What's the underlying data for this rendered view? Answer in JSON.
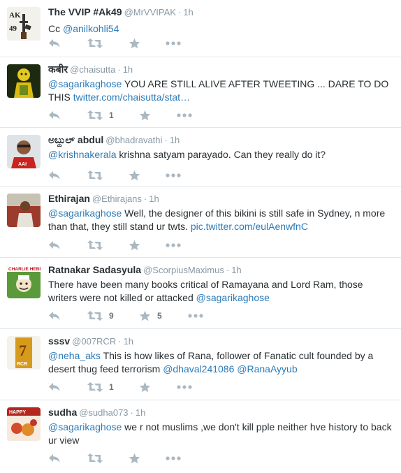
{
  "tweets": [
    {
      "name": "The VVIP #Ak49",
      "handle": "@MrVVIPAK",
      "time": "1h",
      "text_parts": [
        "Cc "
      ],
      "mentions": [
        "@anilkohli54"
      ],
      "avatar_icon": "rifle-ak49-avatar",
      "retweets": "",
      "favorites": ""
    },
    {
      "name": "कबीर",
      "handle": "@chaisutta",
      "time": "1h",
      "mention": "@sagarikaghose",
      "text_line1": " YOU ARE STILL ALIVE AFTER TWEETING ... DARE TO DO",
      "text_line2": "THIS ",
      "link": "twitter.com/chaisutta/stat…",
      "avatar_icon": "yellow-figure-avatar",
      "retweets": "1",
      "favorites": ""
    },
    {
      "name": "ಅಬ್ದುಲ್ abdul",
      "handle": "@bhadravathi",
      "time": "1h",
      "mention": "@krishnakerala",
      "text": " krishna satyam parayado. Can they really do it?",
      "avatar_icon": "man-red-shirt-avatar",
      "retweets": "",
      "favorites": ""
    },
    {
      "name": "Ethirajan",
      "handle": "@Ethirajans",
      "time": "1h",
      "mention": "@sagarikaghose",
      "text_line1": " Well, the designer of this bikini is still safe in Sydney, n more",
      "text_line2": "than that, they still stand ur twts. ",
      "link": "pic.twitter.com/eulAenwfnC",
      "avatar_icon": "person-photo-avatar",
      "retweets": "",
      "favorites": ""
    },
    {
      "name": "Ratnakar Sadasyula",
      "handle": "@ScorpiusMaximus",
      "time": "1h",
      "text_line1": "There have been many books critical of Ramayana and Lord Ram, those",
      "text_line2": "writers were not killed or attacked ",
      "mention": "@sagarikaghose",
      "avatar_icon": "charlie-hebdo-cover-avatar",
      "retweets": "9",
      "favorites": "5"
    },
    {
      "name": "sssv",
      "handle": "@007RCR",
      "time": "1h",
      "mention": "@neha_aks",
      "text_line1": " This is how likes of  Rana, follower of Fanatic cult founded by a",
      "text_line2": "desert thug feed terrorism ",
      "mention2": "@dhaval241086",
      "mention3": "@RanaAyyub",
      "avatar_icon": "7-rcr-logo-avatar",
      "retweets": "1",
      "favorites": ""
    },
    {
      "name": "sudha",
      "handle": "@sudha073",
      "time": "1h",
      "mention": "@sagarikaghose",
      "text_line1": " we r not muslims ,we don't kill pple neither hve history to back",
      "text_line2": "ur view",
      "avatar_icon": "happy-new-year-avatar",
      "retweets": "",
      "favorites": ""
    }
  ],
  "icons": {
    "reply": "reply-icon",
    "retweet": "retweet-icon",
    "favorite": "star-icon",
    "more": "more-icon"
  },
  "colors": {
    "link": "#2b7bb9",
    "meta": "#8899a6",
    "divider": "#e1e8ed"
  },
  "dot": "·"
}
